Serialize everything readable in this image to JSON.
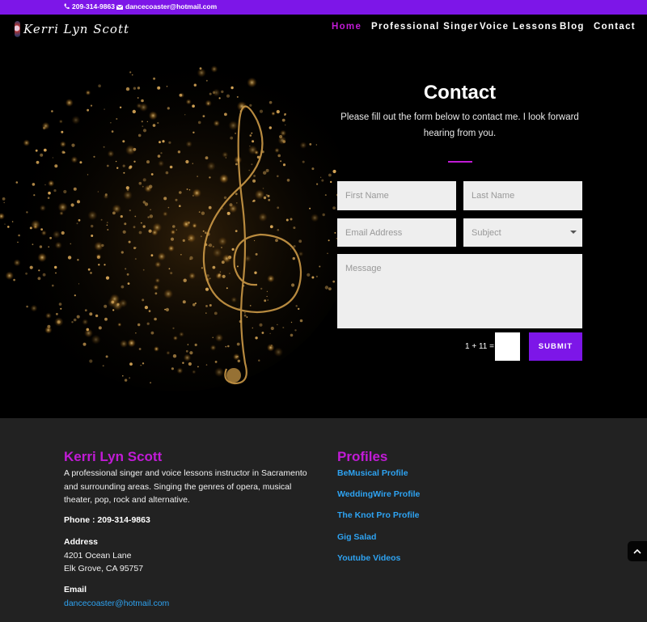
{
  "topbar": {
    "phone": "209-314-9863",
    "email": "dancecoaster@hotmail.com",
    "background": "#7d16e8"
  },
  "header": {
    "logo_text": "Kerri Lyn Scott",
    "nav": [
      {
        "label": "Home",
        "active": true
      },
      {
        "label": "Professional Singer",
        "active": false
      },
      {
        "label": "Voice Lessons",
        "active": false
      },
      {
        "label": "Blog",
        "active": false
      },
      {
        "label": "Contact",
        "active": false
      }
    ],
    "active_color": "#c11bd6"
  },
  "contact": {
    "title": "Contact",
    "intro": "Please fill out the form below to contact me. I look forward hearing from you.",
    "form": {
      "first_name_placeholder": "First Name",
      "last_name_placeholder": "Last Name",
      "email_placeholder": "Email Address",
      "subject_placeholder": "Subject",
      "message_placeholder": "Message",
      "captcha_question": "1 + 11 =",
      "submit_label": "SUBMIT"
    }
  },
  "footer": {
    "about": {
      "title": "Kerri Lyn Scott",
      "text": "A professional singer and voice lessons instructor in Sacramento and surrounding areas. Singing the genres of opera, musical theater, pop, rock and alternative.",
      "phone_line": "Phone : 209-314-9863",
      "address_heading": "Address",
      "address_line1": "4201 Ocean Lane",
      "address_line2": "Elk Grove, CA 95757",
      "email_heading": "Email",
      "email": "dancecoaster@hotmail.com"
    },
    "profiles": {
      "title": "Profiles",
      "links": [
        "BeMusical Profile",
        "WeddingWire Profile",
        "The Knot Pro Profile",
        "Gig Salad",
        "Youtube Videos"
      ]
    },
    "accent_color": "#c11bd6",
    "link_color": "#2ea3f2"
  },
  "icons": [
    "phone-icon",
    "email-icon",
    "logo-image",
    "treble-clef-image",
    "dropdown-arrow-icon",
    "chevron-up-icon"
  ]
}
